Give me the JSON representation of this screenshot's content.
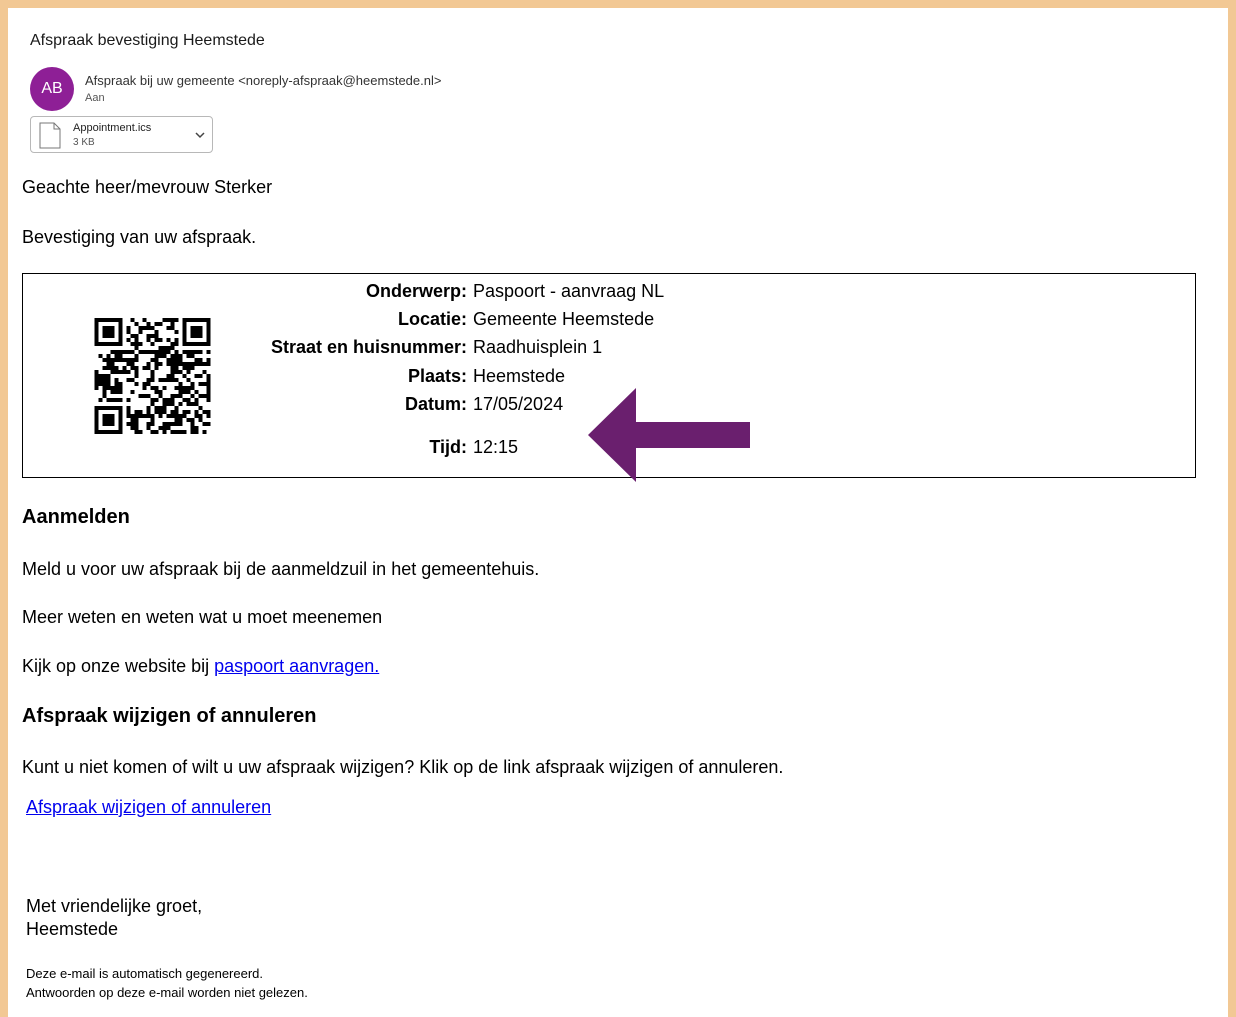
{
  "email": {
    "subject": "Afspraak bevestiging Heemstede",
    "avatar_initials": "AB",
    "sender": "Afspraak bij uw gemeente <noreply-afspraak@heemstede.nl>",
    "to_label": "Aan",
    "attachment": {
      "name": "Appointment.ics",
      "size": "3 KB"
    }
  },
  "body": {
    "greeting": "Geachte heer/mevrouw Sterker",
    "intro": "Bevestiging van uw afspraak.",
    "details": [
      {
        "label": "Onderwerp:",
        "value": "Paspoort - aanvraag NL"
      },
      {
        "label": "Locatie:",
        "value": "Gemeente Heemstede"
      },
      {
        "label": "Straat en huisnummer:",
        "value": "Raadhuisplein 1"
      },
      {
        "label": "Plaats:",
        "value": "Heemstede"
      },
      {
        "label": "Datum:",
        "value": "17/05/2024"
      },
      {
        "label": "Tijd:",
        "value": "12:15"
      }
    ],
    "section1_title": "Aanmelden",
    "section1_text": "Meld u voor uw afspraak bij de aanmeldzuil in het gemeentehuis.",
    "more_info": "Meer weten en weten wat u moet meenemen",
    "website_prefix": "Kijk op onze website bij ",
    "website_link": "paspoort aanvragen.",
    "section2_title": "Afspraak wijzigen of annuleren",
    "section2_text": "Kunt u niet komen of wilt u uw afspraak wijzigen? Klik op de link afspraak wijzigen of annuleren.",
    "change_link": "Afspraak wijzigen of annuleren",
    "closing": "Met vriendelijke groet,",
    "signature": "Heemstede",
    "footer1": "Deze e-mail is automatisch gegenereerd.",
    "footer2": "Antwoorden op deze e-mail worden niet gelezen."
  },
  "colors": {
    "frame": "#f2c894",
    "avatar": "#8e1f96",
    "arrow": "#6a1f6e",
    "link": "#0000ee"
  }
}
